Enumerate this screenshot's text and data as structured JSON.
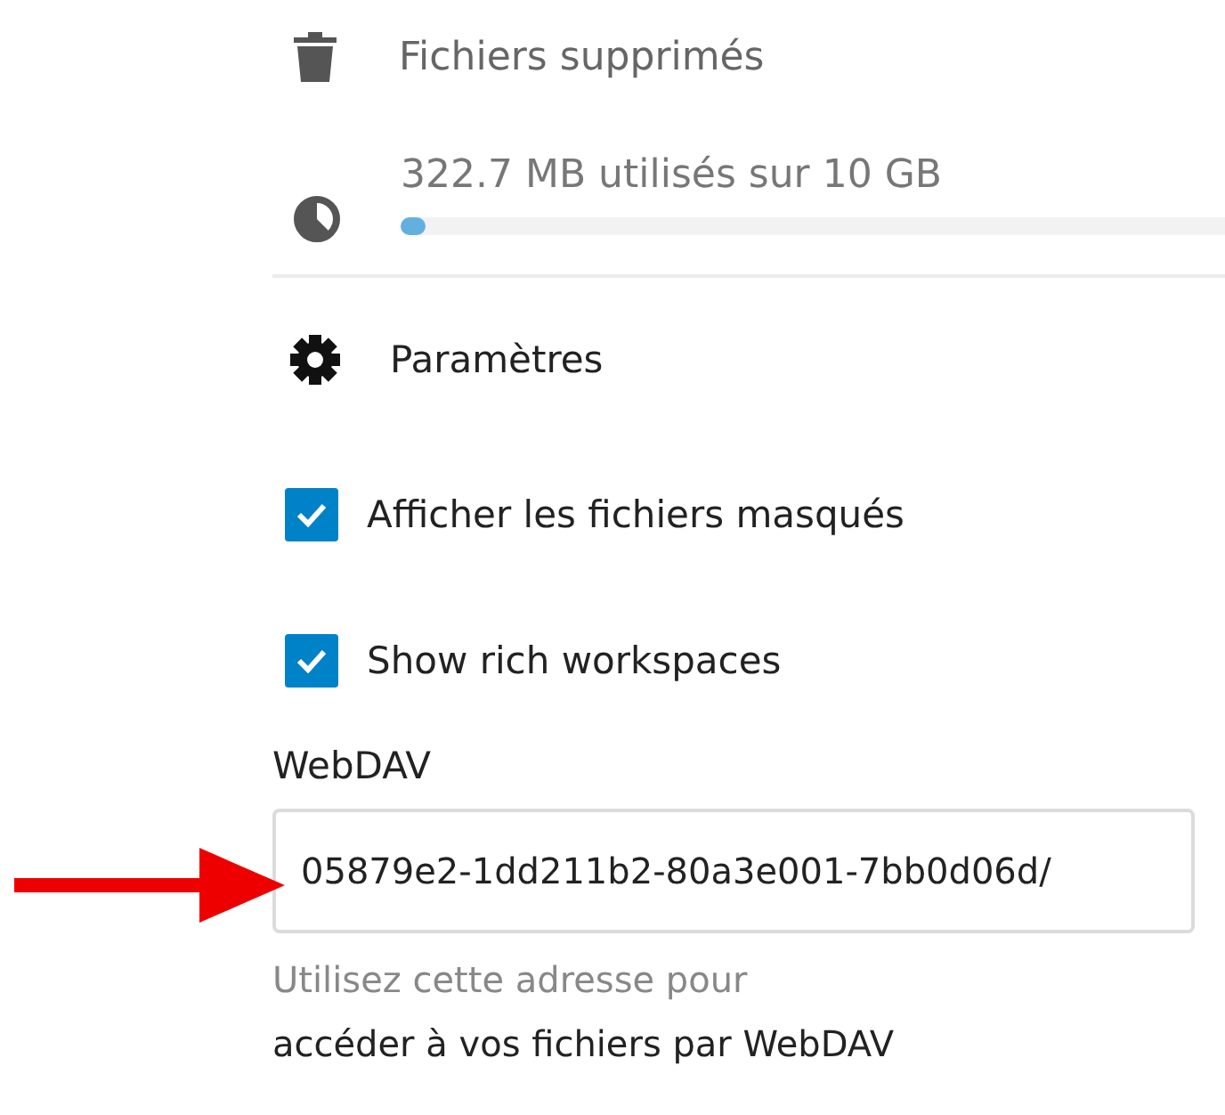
{
  "navigation": [
    {
      "kind": "trash",
      "label": "Fichiers supprimés"
    }
  ],
  "quota": {
    "text": "322.7 MB utilisés sur 10 GB",
    "level": 0.03
  },
  "settings": {
    "label": "Paramètres",
    "options": [
      {
        "label": "Afficher les fichiers masqués",
        "checked": true
      },
      {
        "label": "Show rich workspaces",
        "checked": true
      }
    ],
    "webdav": {
      "label": "WebDAV",
      "value": "05879e2-1dd211b2-80a3e001-7bb0d06d/",
      "hint": "Utilisez cette adresse pour ",
      "link": "accéder à vos fichiers par WebDAV"
    }
  },
  "annotation": {
    "kind": "arrow"
  }
}
